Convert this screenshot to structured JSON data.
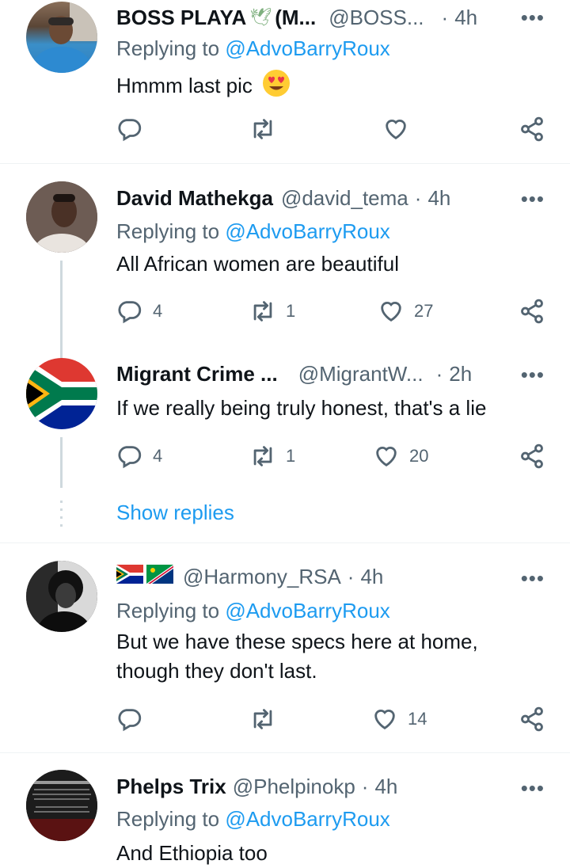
{
  "colors": {
    "accent": "#1d9bf0",
    "secondary": "#536471",
    "text": "#0f1419",
    "divider": "#eff3f4"
  },
  "tweets": [
    {
      "name": "BOSS PLAYA",
      "name_suffix": "(M...",
      "handle": "@BOSS...",
      "time": "4h",
      "replying_prefix": "Replying to",
      "replying_to": "@AdvoBarryRoux",
      "text": "Hmmm last pic",
      "emoji": "heart-eyes-emoji",
      "replies": "",
      "retweets": "",
      "likes": ""
    },
    {
      "name": "David Mathekga",
      "handle": "@david_tema",
      "time": "4h",
      "replying_prefix": "Replying to",
      "replying_to": "@AdvoBarryRoux",
      "text": "All African women are beautiful",
      "replies": "4",
      "retweets": "1",
      "likes": "27"
    },
    {
      "name": "Migrant Crime ...",
      "handle": "@MigrantW...",
      "time": "2h",
      "text": "If we really being truly honest, that's a lie",
      "replies": "4",
      "retweets": "1",
      "likes": "20"
    },
    {
      "name": "",
      "handle": "@Harmony_RSA",
      "time": "4h",
      "replying_prefix": "Replying to",
      "replying_to": "@AdvoBarryRoux",
      "text_line1": "But we have these specs here at home,",
      "text_line2": "though they don't last.",
      "replies": "",
      "retweets": "",
      "likes": "14"
    },
    {
      "name": "Phelps Trix",
      "handle": "@Phelpinokp",
      "time": "4h",
      "replying_prefix": "Replying to",
      "replying_to": "@AdvoBarryRoux",
      "text": "And Ethiopia too"
    }
  ],
  "show_replies": "Show replies",
  "separator": "·",
  "more": "•••"
}
